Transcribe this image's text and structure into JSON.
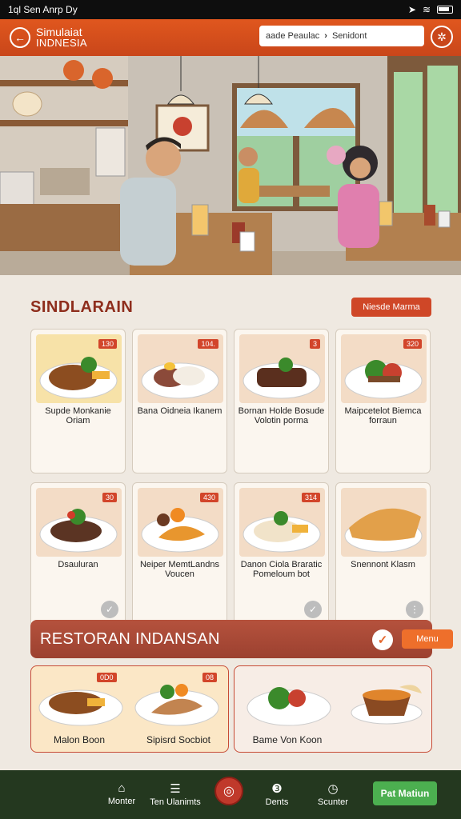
{
  "status_bar": {
    "time_text": "1ql Sen Anrp Dy"
  },
  "header": {
    "brand_line1": "Simulaiat",
    "brand_line2": "INDNESIA",
    "search_left": "aade Peaulac",
    "search_right": "Senidont"
  },
  "section": {
    "title": "SINDLARAIN",
    "see_all": "Niesde Marma"
  },
  "menu_items": [
    {
      "name": "Supde Monkanie Oriam",
      "price": "130"
    },
    {
      "name": "Bana Oidneia Ikanem",
      "price": "104."
    },
    {
      "name": "Bornan Holde Bosude Volotin porma",
      "price": "3"
    },
    {
      "name": "Maipcetelot Biemca forraun",
      "price": "320"
    },
    {
      "name": "Dsauluran",
      "price": "30"
    },
    {
      "name": "Neiper MemtLandns Voucen",
      "price": "430"
    },
    {
      "name": "Danon Ciola Braratic Pomeloum bot",
      "price": "314"
    },
    {
      "name": "Snennont Klasm",
      "price": ""
    }
  ],
  "restaurant": {
    "title": "RESTORAN INDANSAN",
    "menu_button": "Menu"
  },
  "bottom_cards": [
    {
      "left_caption": "Malon Boon",
      "left_tag": "0D0",
      "right_caption": "Sipisrd Socbiot",
      "right_tag": "08"
    },
    {
      "caption": "Bame Von Koon"
    }
  ],
  "nav": {
    "items": [
      "Monter",
      "Ten Ulanimts",
      "Dents",
      "Scunter"
    ],
    "cta": "Pat Matiun"
  },
  "colors": {
    "brand_orange": "#e0571e",
    "accent_red": "#cf4727",
    "nav_green": "#24381f",
    "cta_green": "#4caf50"
  }
}
